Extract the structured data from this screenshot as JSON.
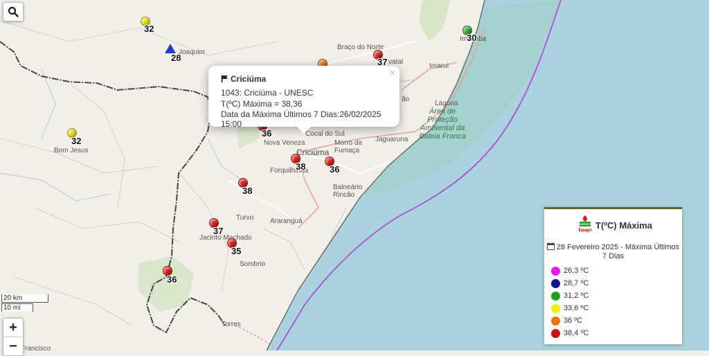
{
  "controls": {
    "zoom_in": "+",
    "zoom_out": "−",
    "scale_km": "20 km",
    "scale_mi": "10 mi"
  },
  "map_labels": [
    {
      "text": "Braço do Norte"
    },
    {
      "text": "Imaruí"
    },
    {
      "text": "Laguna"
    },
    {
      "text": "Bom Jesus"
    },
    {
      "text": "Nova Veneza"
    },
    {
      "text": "Cocal do Sul"
    },
    {
      "text": "Morro da Fumaça"
    },
    {
      "text": "Criciúma"
    },
    {
      "text": "Forquilhinha"
    },
    {
      "text": "Jaguaruna"
    },
    {
      "text": "Balneário Rincão"
    },
    {
      "text": "Turvo"
    },
    {
      "text": "Araranguá"
    },
    {
      "text": "Jacinto Machado"
    },
    {
      "text": "Sombrio"
    },
    {
      "text": "Torres"
    },
    {
      "text": "Área de Proteção Ambiental da Baleia Franca"
    },
    {
      "text": "Imbituba"
    },
    {
      "text": "Joaquim"
    },
    {
      "text": "vatal"
    },
    {
      "text": "ão"
    },
    {
      "text": "Francisco"
    }
  ],
  "stations": [
    {
      "value": "32",
      "color": "#e8e21a"
    },
    {
      "value": "28",
      "color": "#1f3fbf",
      "shape": "triangle"
    },
    {
      "value": "37",
      "color": "#d62020"
    },
    {
      "value": "30",
      "color": "#2ea82e"
    },
    {
      "value": "",
      "color": "#f07020"
    },
    {
      "value": "32",
      "color": "#e8e21a"
    },
    {
      "value": "36",
      "color": "#d62020"
    },
    {
      "value": "38",
      "color": "#d62020"
    },
    {
      "value": "36",
      "color": "#d62020"
    },
    {
      "value": "38",
      "color": "#d62020"
    },
    {
      "value": "37",
      "color": "#d62020"
    },
    {
      "value": "35",
      "color": "#d62020"
    },
    {
      "value": "36",
      "color": "#d62020"
    }
  ],
  "popup": {
    "title": "Criciúma",
    "line1": "1043: Criciúma - UNESC",
    "line2": "T(ºC) Máxima = 38,36",
    "line3": "Data da Máxima Últimos 7 Dias:26/02/2025 15:00",
    "close": "×",
    "flag_icon": "flag-icon"
  },
  "legend": {
    "logo_text": "Epagri",
    "title": "T(ºC) Máxima",
    "date_line1": "28 Fevereiro 2025 - Máxima Últimos",
    "date_line2": "7 Dias",
    "items": [
      {
        "label": "26,3 ºC",
        "color": "#e020e0"
      },
      {
        "label": "28,7 ºC",
        "color": "#101090"
      },
      {
        "label": "31,2 ºC",
        "color": "#20a020"
      },
      {
        "label": "33,6 ºC",
        "color": "#f0f000"
      },
      {
        "label": "36 ºC",
        "color": "#f07010"
      },
      {
        "label": "38,4 ºC",
        "color": "#d01010"
      }
    ]
  },
  "colors": {
    "ocean": "#aad3df",
    "land": "#f2efe9",
    "coast_green": "#c8dcb0",
    "border": "#444444"
  }
}
